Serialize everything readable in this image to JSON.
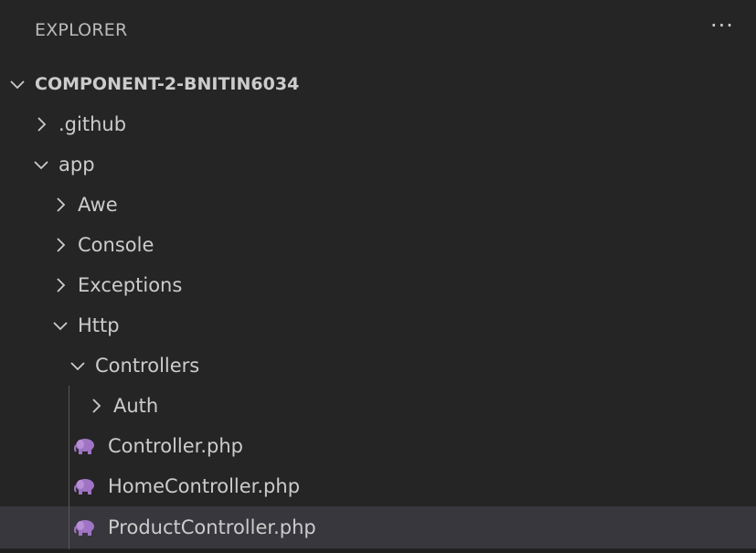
{
  "explorer": {
    "title": "EXPLORER",
    "more_actions": "···"
  },
  "tree": {
    "root": {
      "label": "COMPONENT-2-BNITIN6034",
      "expanded": true
    },
    "items": [
      {
        "label": ".github",
        "type": "folder",
        "expanded": false
      },
      {
        "label": "app",
        "type": "folder",
        "expanded": true
      },
      {
        "label": "Awe",
        "type": "folder",
        "expanded": false
      },
      {
        "label": "Console",
        "type": "folder",
        "expanded": false
      },
      {
        "label": "Exceptions",
        "type": "folder",
        "expanded": false
      },
      {
        "label": "Http",
        "type": "folder",
        "expanded": true
      },
      {
        "label": "Controllers",
        "type": "folder",
        "expanded": true
      },
      {
        "label": "Auth",
        "type": "folder",
        "expanded": false
      },
      {
        "label": "Controller.php",
        "type": "php-file"
      },
      {
        "label": "HomeController.php",
        "type": "php-file"
      },
      {
        "label": "ProductController.php",
        "type": "php-file",
        "selected": true
      }
    ]
  },
  "colors": {
    "background": "#252526",
    "selected_row": "#37373d",
    "text": "#cccccc",
    "php_icon": "#a074c4"
  }
}
